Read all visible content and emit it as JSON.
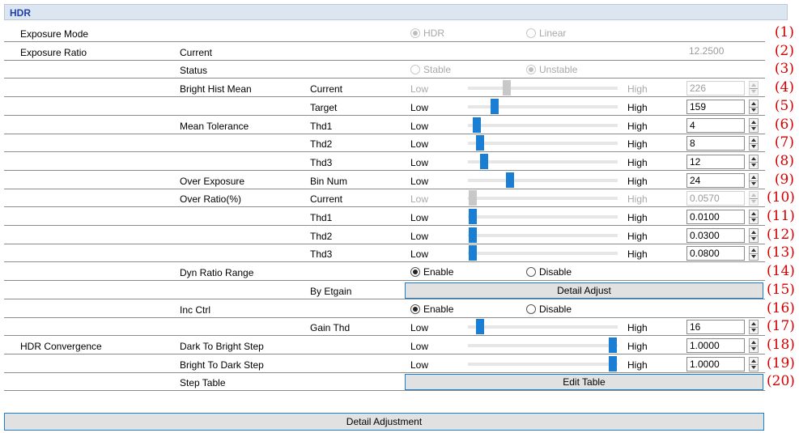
{
  "header": {
    "title": "HDR"
  },
  "rows": [
    {
      "c1": "Exposure Mode",
      "radios": [
        {
          "label": "HDR",
          "checked": true
        },
        {
          "label": "Linear",
          "checked": false
        }
      ],
      "disabled": true
    },
    {
      "c1": "Exposure Ratio",
      "c2": "Current",
      "value": "12.2500",
      "readonly": true
    },
    {
      "c2": "Status",
      "radios": [
        {
          "label": "Stable",
          "checked": false
        },
        {
          "label": "Unstable",
          "checked": true
        }
      ],
      "disabled": true
    },
    {
      "c2": "Bright Hist Mean",
      "c3": "Current",
      "low": "Low",
      "high": "High",
      "slider": 0.26,
      "value": "226",
      "disabled": true
    },
    {
      "c3": "Target",
      "low": "Low",
      "high": "High",
      "slider": 0.18,
      "value": "159"
    },
    {
      "c2": "Mean Tolerance",
      "c3": "Thd1",
      "low": "Low",
      "high": "High",
      "slider": 0.06,
      "value": "4"
    },
    {
      "c3": "Thd2",
      "low": "Low",
      "high": "High",
      "slider": 0.08,
      "value": "8"
    },
    {
      "c3": "Thd3",
      "low": "Low",
      "high": "High",
      "slider": 0.11,
      "value": "12"
    },
    {
      "c2": "Over Exposure",
      "c3": "Bin Num",
      "low": "Low",
      "high": "High",
      "slider": 0.28,
      "value": "24"
    },
    {
      "c2": "Over Ratio(%)",
      "c3": "Current",
      "low": "Low",
      "high": "High",
      "slider": 0.03,
      "value": "0.0570",
      "disabled": true
    },
    {
      "c3": "Thd1",
      "low": "Low",
      "high": "High",
      "slider": 0.03,
      "value": "0.0100"
    },
    {
      "c3": "Thd2",
      "low": "Low",
      "high": "High",
      "slider": 0.03,
      "value": "0.0300"
    },
    {
      "c3": "Thd3",
      "low": "Low",
      "high": "High",
      "slider": 0.03,
      "value": "0.0800"
    },
    {
      "c2": "Dyn Ratio Range",
      "radios": [
        {
          "label": "Enable",
          "checked": true
        },
        {
          "label": "Disable",
          "checked": false
        }
      ]
    },
    {
      "c3": "By Etgain",
      "button": "Detail Adjust"
    },
    {
      "c2": "Inc Ctrl",
      "radios": [
        {
          "label": "Enable",
          "checked": true
        },
        {
          "label": "Disable",
          "checked": false
        }
      ]
    },
    {
      "c3": "Gain Thd",
      "low": "Low",
      "high": "High",
      "slider": 0.08,
      "value": "16"
    },
    {
      "c1": "HDR Convergence",
      "c2": "Dark To Bright Step",
      "low": "Low",
      "high": "High",
      "slider": 0.97,
      "value": "1.0000"
    },
    {
      "c2": "Bright To Dark Step",
      "low": "Low",
      "high": "High",
      "slider": 0.97,
      "value": "1.0000"
    },
    {
      "c2": "Step Table",
      "button": "Edit Table"
    }
  ],
  "numbers": [
    "(1)",
    "(2)",
    "(3)",
    "(4)",
    "(5)",
    "(6)",
    "(7)",
    "(8)",
    "(9)",
    "(10)",
    "(11)",
    "(12)",
    "(13)",
    "(14)",
    "(15)",
    "(16)",
    "(17)",
    "(18)",
    "(19)",
    "(20)"
  ],
  "bottom_button": "Detail Adjustment",
  "colors": {
    "accent": "#1a7fd4",
    "header_bg": "#dbe6f1",
    "header_text": "#1f3faa",
    "annotation": "#d40000"
  }
}
